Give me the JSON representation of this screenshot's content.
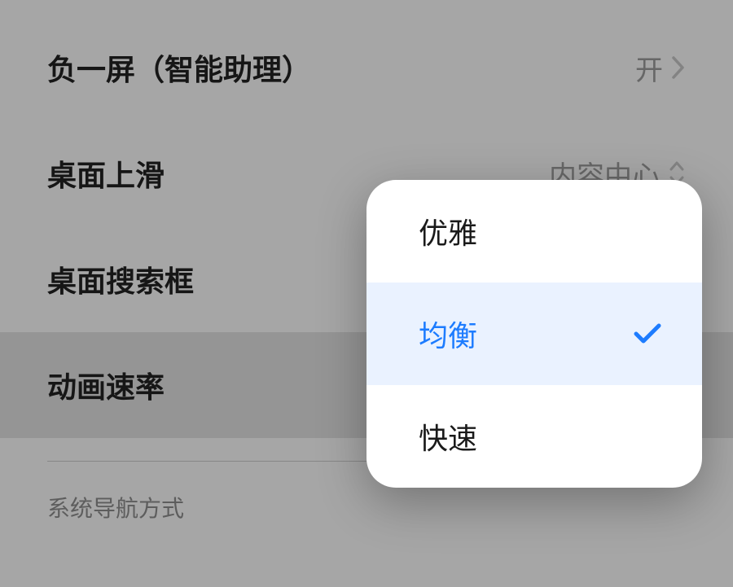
{
  "settings": {
    "rows": [
      {
        "label": "负一屏（智能助理）",
        "value": "开",
        "accessory": "chevron"
      },
      {
        "label": "桌面上滑",
        "value": "内容中心",
        "accessory": "updown"
      },
      {
        "label": "桌面搜索框",
        "value": "",
        "accessory": "none"
      },
      {
        "label": "动画速率",
        "value": "",
        "accessory": "none",
        "highlighted": true
      }
    ],
    "section_header": "系统导航方式"
  },
  "popup": {
    "options": [
      {
        "label": "优雅",
        "selected": false
      },
      {
        "label": "均衡",
        "selected": true
      },
      {
        "label": "快速",
        "selected": false
      }
    ]
  },
  "colors": {
    "accent": "#1d7cff",
    "selected_bg": "#eaf2ff"
  }
}
